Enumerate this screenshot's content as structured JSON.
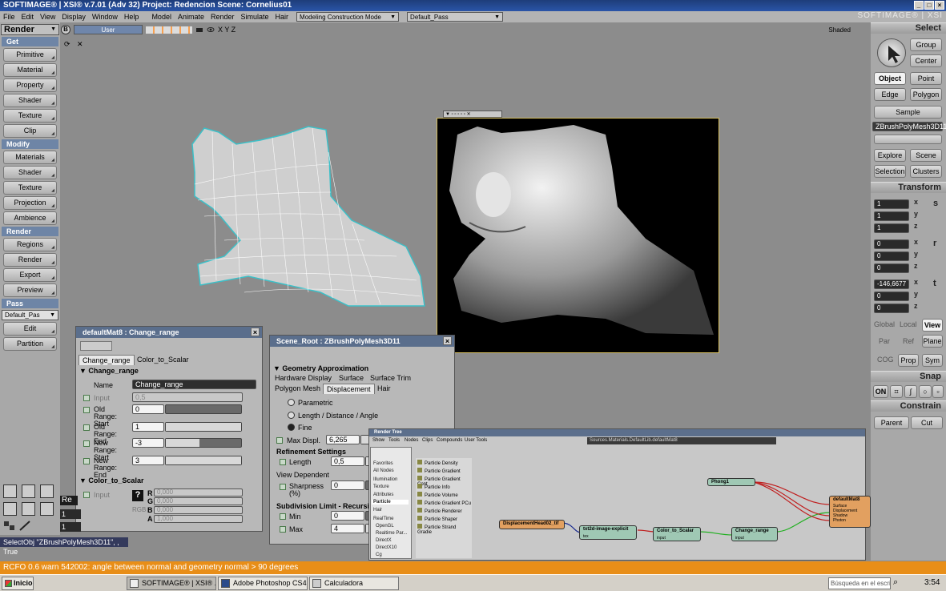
{
  "window": {
    "title": "SOFTIMAGE® | XSI® v.7.01 (Adv 32) Project: Redencion    Scene: Cornelius01",
    "brand": "SOFTIMAGE® | XSI"
  },
  "menu": {
    "items": [
      "File",
      "Edit",
      "View",
      "Display",
      "Window",
      "Help",
      "Model",
      "Animate",
      "Render",
      "Simulate",
      "Hair"
    ],
    "mode_dropdown": "Modeling Construction Mode",
    "pass_dropdown": "Default_Pass"
  },
  "left_panel": {
    "module": "Render",
    "sections": [
      {
        "title": "Get",
        "buttons": [
          "Primitive",
          "Material",
          "Property",
          "Shader",
          "Texture",
          "Clip"
        ]
      },
      {
        "title": "Modify",
        "buttons": [
          "Materials",
          "Shader",
          "Texture",
          "Projection",
          "Ambience"
        ]
      },
      {
        "title": "Render",
        "buttons": [
          "Regions",
          "Render",
          "Export",
          "Preview"
        ]
      },
      {
        "title": "Pass",
        "buttons": [
          "Edit",
          "Partition"
        ]
      }
    ],
    "pass_value": "Default_Pas"
  },
  "viewport": {
    "letter": "B",
    "camera": "User",
    "axes": "X Y Z",
    "shading": "Shaded"
  },
  "right_panel": {
    "select_title": "Select",
    "group": "Group",
    "center": "Center",
    "object": "Object",
    "point": "Point",
    "edge": "Edge",
    "polygon": "Polygon",
    "sample": "Sample",
    "selection_name": "ZBrushPolyMesh3D11",
    "explore": "Explore",
    "scene": "Scene",
    "selection": "Selection",
    "clusters": "Clusters",
    "transform_title": "Transform",
    "scale": [
      "1",
      "1",
      "1"
    ],
    "rotate": [
      "0",
      "0",
      "0"
    ],
    "translate": [
      "-146,6677",
      "0",
      "0"
    ],
    "axis_labels": [
      "x",
      "y",
      "z"
    ],
    "srt": [
      "s",
      "r",
      "t"
    ],
    "ref_row1": [
      "Global",
      "Local",
      "View"
    ],
    "ref_row2": [
      "Par",
      "Ref",
      "Plane"
    ],
    "cog_row": [
      "COG",
      "Prop",
      "Sym"
    ],
    "snap_title": "Snap",
    "snap_on": "ON",
    "constrain_title": "Constrain",
    "parent": "Parent",
    "cut": "Cut"
  },
  "mat_editor": {
    "title": "defaultMat8 : Change_range",
    "tabs": [
      "Change_range",
      "Color_to_Scalar"
    ],
    "section1": "Change_range",
    "name_label": "Name",
    "name_value": "Change_range",
    "input_label": "Input",
    "input_value": "0,5",
    "old_start_label": "Old Range: Start",
    "old_start": "0",
    "old_end_label": "Old Range: End",
    "old_end": "1",
    "new_start_label": "New Range: Start",
    "new_start": "-3",
    "new_end_label": "New Range: End",
    "new_end": "3",
    "section2": "Color_to_Scalar",
    "input2_label": "Input",
    "rgb_label": "RGB",
    "channels": [
      {
        "k": "R",
        "v": "0,000"
      },
      {
        "k": "G",
        "v": "0,000"
      },
      {
        "k": "B",
        "v": "0,000"
      },
      {
        "k": "A",
        "v": "1,000"
      }
    ]
  },
  "geo_editor": {
    "title": "Scene_Root : ZBrushPolyMesh3D11",
    "section": "Geometry Approximation",
    "tabs_row1": [
      "Hardware Display",
      "Surface",
      "Surface Trim"
    ],
    "tabs_row2": [
      "Polygon Mesh",
      "Displacement",
      "Hair"
    ],
    "opt_parametric": "Parametric",
    "opt_length": "Length / Distance / Angle",
    "opt_fine": "Fine",
    "max_displ_label": "Max Displ.",
    "max_displ": "6,265",
    "refinement": "Refinement Settings",
    "length_label": "Length",
    "length_value": "0,5",
    "view_dependent": "View Dependent",
    "sharpness_label": "Sharpness (%)",
    "sharpness_value": "0",
    "subdiv_section": "Subdivision Limit - Recursive",
    "min_label": "Min",
    "min_value": "0",
    "max_label": "Max",
    "max_value": "4"
  },
  "render_tree": {
    "title": "Render Tree",
    "menu": [
      "Show",
      "Tools",
      "Nodes",
      "Clips",
      "Compounds",
      "User Tools"
    ],
    "path": "Sources.Materials.DefaultLib.defaultMat8",
    "categories": [
      "Favorites",
      "All Nodes",
      "Illumination",
      "Texture",
      "Attributes",
      "Particle",
      "Hair",
      "RealTime",
      "OpenGL",
      "Realtime Par...",
      "DirectX",
      "DirectX10",
      "Cg"
    ],
    "items": [
      "Particle Density",
      "Particle Gradient",
      "Particle Gradient Cont",
      "Particle Info",
      "Particle Volume",
      "Particle Gradient PCu",
      "Particle Renderer",
      "Particle Shaper",
      "Particle Strand Gradie"
    ],
    "nodes": {
      "image": "DisplacementHead02_tif",
      "txt2d": "txt2d-image-explicit",
      "tex": "tex",
      "cts": "Color_to_Scalar",
      "input": "input",
      "cr": "Change_range",
      "input2": "input",
      "phong": "Phong1",
      "mat": "defaultMat8",
      "ports": [
        "Surface",
        "Displacement",
        "Shadow",
        "Photon"
      ]
    }
  },
  "bottom": {
    "cmd": "SelectObj \"ZBrushPolyMesh3D11\", , True",
    "status": "RCFO 0.6  warn   542002: angle between normal and geometry normal > 90 degrees",
    "timeline_label": "Re",
    "frames": [
      "1",
      "1"
    ]
  },
  "taskbar": {
    "start": "Inicio",
    "tasks": [
      "SOFTIMAGE® | XSI® ...",
      "Adobe Photoshop CS4 - ...",
      "Calculadora"
    ],
    "search": "Búsqueda en el escrit",
    "time": "3:54"
  }
}
